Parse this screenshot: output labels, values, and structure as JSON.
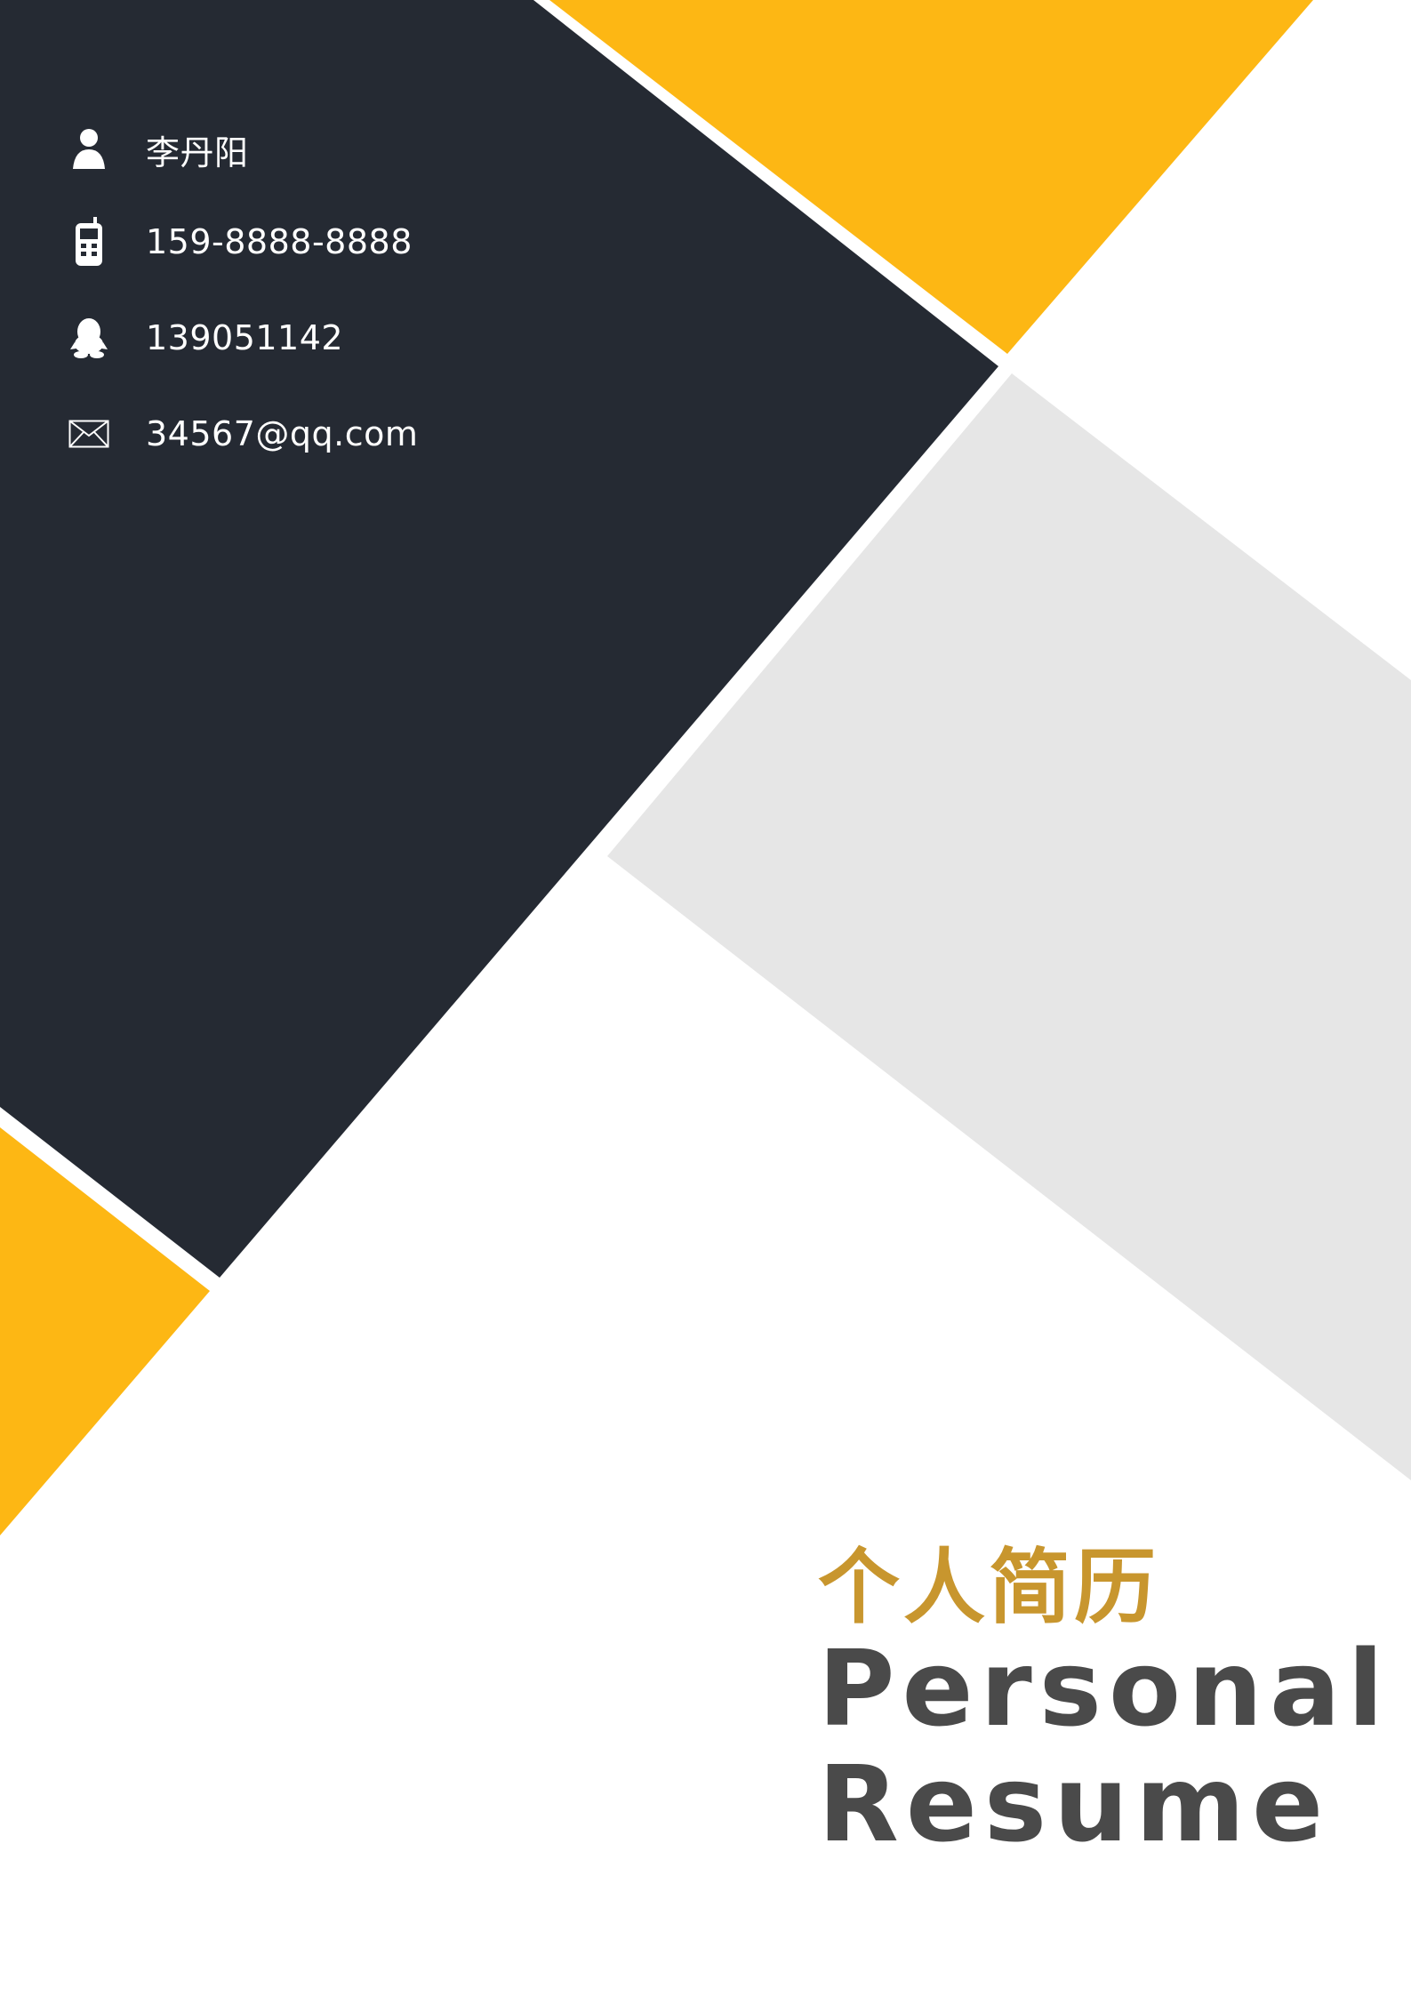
{
  "contact": {
    "name": "李丹阳",
    "phone": "159-8888-8888",
    "qq": "139051142",
    "email": "34567@qq.com"
  },
  "title": {
    "chinese": "个人简历",
    "english_line1": "Personal",
    "english_line2": "Resume"
  },
  "icons": {
    "name": "person-icon",
    "phone": "mobile-phone-icon",
    "qq": "qq-penguin-icon",
    "email": "envelope-icon"
  },
  "colors": {
    "dark_panel": "#252a33",
    "accent_yellow": "#fdb714",
    "light_gray": "#e6e6e6",
    "title_gold": "#c8962e",
    "title_gray": "#4a4a4a"
  }
}
